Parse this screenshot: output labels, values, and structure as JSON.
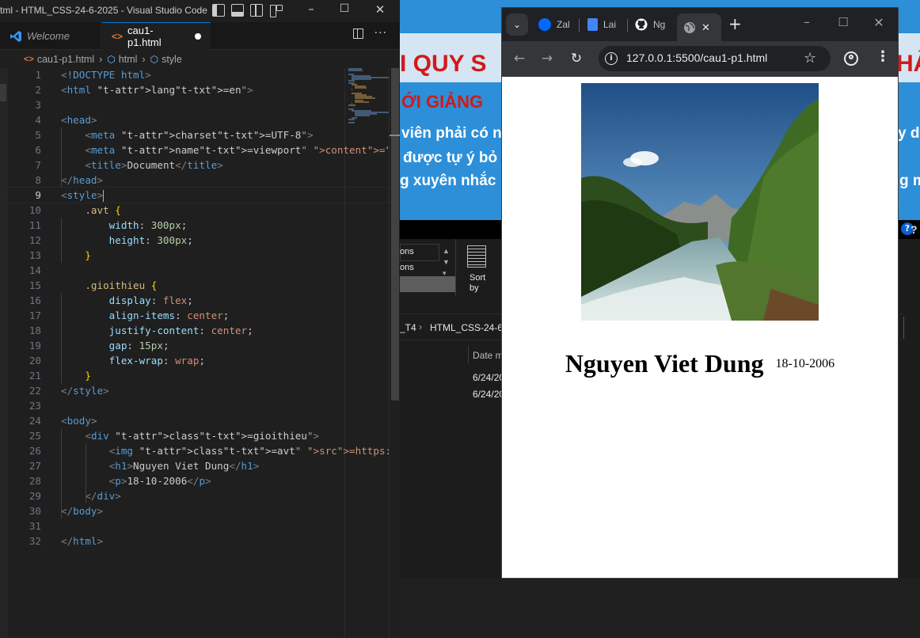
{
  "vscode": {
    "title": "tml - HTML_CSS-24-6-2025 - Visual Studio Code",
    "tabs": [
      {
        "label": "Welcome",
        "active": false
      },
      {
        "label": "cau1-p1.html",
        "active": true,
        "modified": true
      }
    ],
    "breadcrumb": [
      "cau1-p1.html",
      "html",
      "style"
    ],
    "current_line": 9,
    "code_lines": [
      "<!DOCTYPE html>",
      "<html lang=\"en\">",
      "",
      "<head>",
      "    <meta charset=\"UTF-8\">",
      "    <meta name=\"viewport\" content=\"width=device",
      "    <title>Document</title>",
      "</head>",
      "<style>",
      "    .avt {",
      "        width: 300px;",
      "        height: 300px;",
      "    }",
      "",
      "    .gioithieu {",
      "        display: flex;",
      "        align-items: center;",
      "        justify-content: center;",
      "        gap: 15px;",
      "        flex-wrap: wrap;",
      "    }",
      "</style>",
      "",
      "<body>",
      "    <div class=\"gioithieu\">",
      "        <img class=\"avt\" src=\"https://images.pe",
      "        <h1>Nguyen Viet Dung</h1>",
      "        <p>18-10-2006</p>",
      "    </div>",
      "</body>",
      "",
      "</html>"
    ]
  },
  "background_window": {
    "banner_lines": [
      "I QUY S",
      "ỚI GIẢNG",
      "viên phải có n",
      "được tự ý bỏ",
      "g xuyên nhắc"
    ],
    "right_letters": [
      "HÀ",
      "y dạ",
      "g m"
    ],
    "ribbon_items": [
      "ons",
      "ons"
    ],
    "sort_label": "Sort",
    "sort_by_label": "by",
    "path": [
      "_T4",
      "HTML_CSS-24-6-"
    ],
    "column_header": "Date m",
    "rows": [
      "6/24/20",
      "6/24/20"
    ]
  },
  "browser": {
    "tabs": [
      {
        "label": "Zal",
        "icon": "zalo-icon",
        "color": "#0068ff"
      },
      {
        "label": "Lai",
        "icon": "docs-icon",
        "color": "#4285f4"
      },
      {
        "label": "Ng",
        "icon": "github-icon",
        "color": "#ffffff"
      },
      {
        "label": "",
        "icon": "globe-icon",
        "color": "#9aa0a6",
        "active": true
      }
    ],
    "url": "127.0.0.1:5500/cau1-p1.html"
  },
  "page": {
    "name": "Nguyen Viet Dung",
    "dob": "18-10-2006"
  }
}
